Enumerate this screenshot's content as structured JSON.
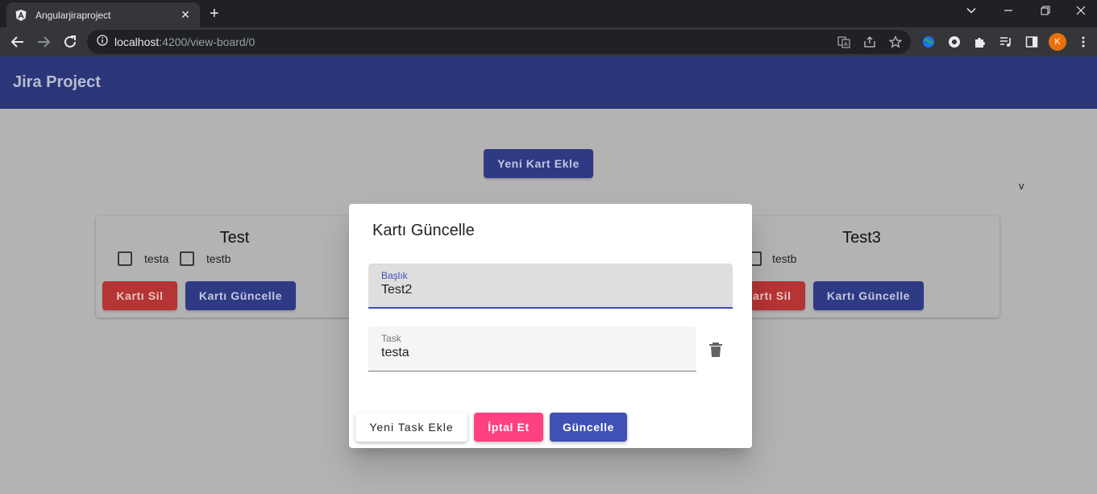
{
  "browser": {
    "tab_title": "Angularjiraproject",
    "url_host": "localhost",
    "url_rest": ":4200/view-board/0",
    "profile_initial": "K"
  },
  "app": {
    "title": "Jira Project",
    "add_card_label": "Yeni Kart Ekle",
    "stray_text": "v"
  },
  "cards": [
    {
      "title": "Test",
      "tasks": [
        "testa",
        "testb"
      ],
      "delete_label": "Kartı Sil",
      "update_label": "Kartı Güncelle"
    },
    {
      "title": "Test3",
      "tasks": [
        "testb"
      ],
      "delete_label": "Kartı Sil",
      "update_label": "Kartı Güncelle"
    }
  ],
  "dialog": {
    "title": "Kartı Güncelle",
    "title_field": {
      "label": "Başlık",
      "value": "Test2"
    },
    "task_field": {
      "label": "Task",
      "value": "testa"
    },
    "add_task_label": "Yeni Task Ekle",
    "cancel_label": "İptal Et",
    "update_label": "Güncelle"
  },
  "colors": {
    "header": "#2b3679",
    "primary": "#3f51b5",
    "accent": "#ff4081",
    "warn": "#b53434"
  }
}
